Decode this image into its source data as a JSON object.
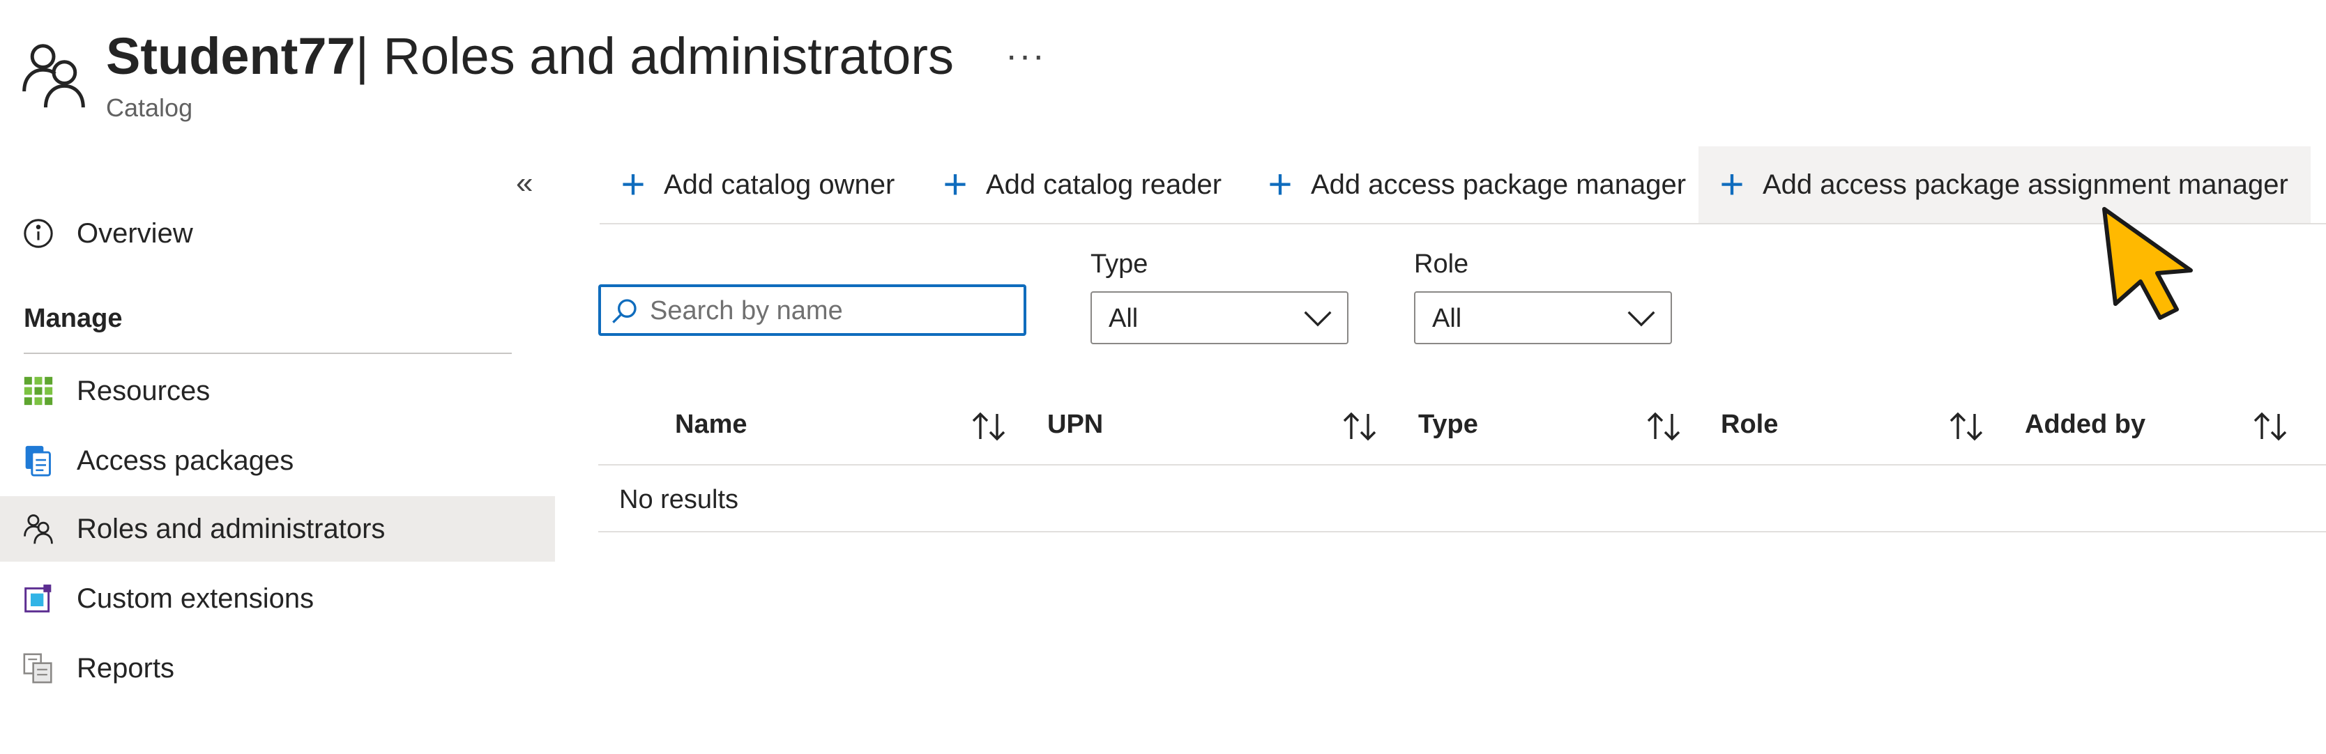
{
  "header": {
    "title_bold": "Student77",
    "title_rest": " | Roles and administrators",
    "subtitle": "Catalog",
    "more": "···",
    "icon": "people-icon"
  },
  "sidebar": {
    "collapse": "«",
    "overview": {
      "label": "Overview",
      "icon": "info-icon"
    },
    "manage_heading": "Manage",
    "items": [
      {
        "label": "Resources",
        "icon": "resources-grid-icon"
      },
      {
        "label": "Access packages",
        "icon": "access-packages-icon"
      },
      {
        "label": "Roles and administrators",
        "icon": "people-icon",
        "active": true
      },
      {
        "label": "Custom extensions",
        "icon": "custom-extensions-icon"
      },
      {
        "label": "Reports",
        "icon": "reports-icon"
      }
    ]
  },
  "toolbar": {
    "buttons": [
      {
        "label": "Add catalog owner"
      },
      {
        "label": "Add catalog reader"
      },
      {
        "label": "Add access package manager"
      },
      {
        "label": "Add access package assignment manager"
      }
    ],
    "more": "…"
  },
  "filters": {
    "search_placeholder": "Search by name",
    "type_label": "Type",
    "type_value": "All",
    "role_label": "Role",
    "role_value": "All"
  },
  "table": {
    "columns": [
      "Name",
      "UPN",
      "Type",
      "Role",
      "Added by"
    ],
    "empty_text": "No results"
  },
  "colors": {
    "accent": "#0f6cbd",
    "active_bg": "#edebe9",
    "cursor": "#ffb900"
  }
}
